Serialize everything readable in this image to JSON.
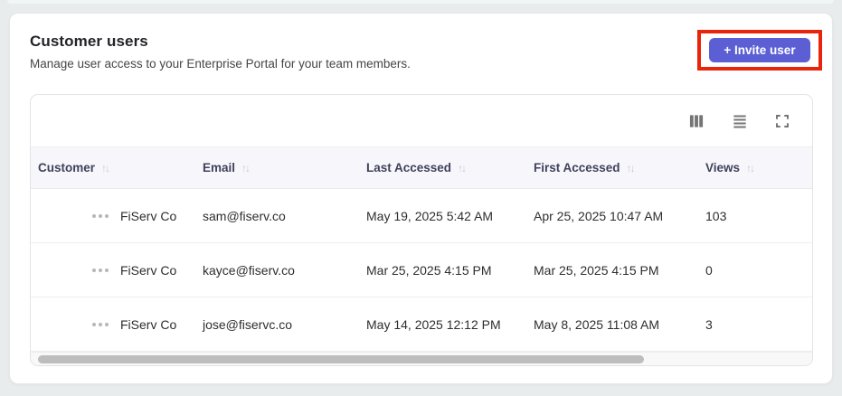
{
  "page": {
    "title": "Customer users",
    "subtitle": "Manage user access to your Enterprise Portal for your team members."
  },
  "invite_button": {
    "label": "+ Invite user"
  },
  "annotation": {
    "highlight_color": "#e8240a"
  },
  "toolbar": {
    "icons": [
      "columns-view",
      "rows-view",
      "expand-fullscreen"
    ]
  },
  "table": {
    "sort_icon": "↑↓",
    "columns": [
      {
        "label": "Customer"
      },
      {
        "label": "Email"
      },
      {
        "label": "Last Accessed"
      },
      {
        "label": "First Accessed"
      },
      {
        "label": "Views"
      }
    ],
    "rows": [
      {
        "customer": "FiServ Co",
        "email": "sam@fiserv.co",
        "last_accessed": "May 19, 2025 5:42 AM",
        "first_accessed": "Apr 25, 2025 10:47 AM",
        "views": "103"
      },
      {
        "customer": "FiServ Co",
        "email": "kayce@fiserv.co",
        "last_accessed": "Mar 25, 2025 4:15 PM",
        "first_accessed": "Mar 25, 2025 4:15 PM",
        "views": "0"
      },
      {
        "customer": "FiServ Co",
        "email": "jose@fiservc.co",
        "last_accessed": "May 14, 2025 12:12 PM",
        "first_accessed": "May 8, 2025 11:08 AM",
        "views": "3"
      }
    ]
  },
  "colors": {
    "accent": "#5b5fd3",
    "highlight_red": "#e8240a",
    "header_bg": "#f7f7fb",
    "page_bg": "#e9eced"
  }
}
